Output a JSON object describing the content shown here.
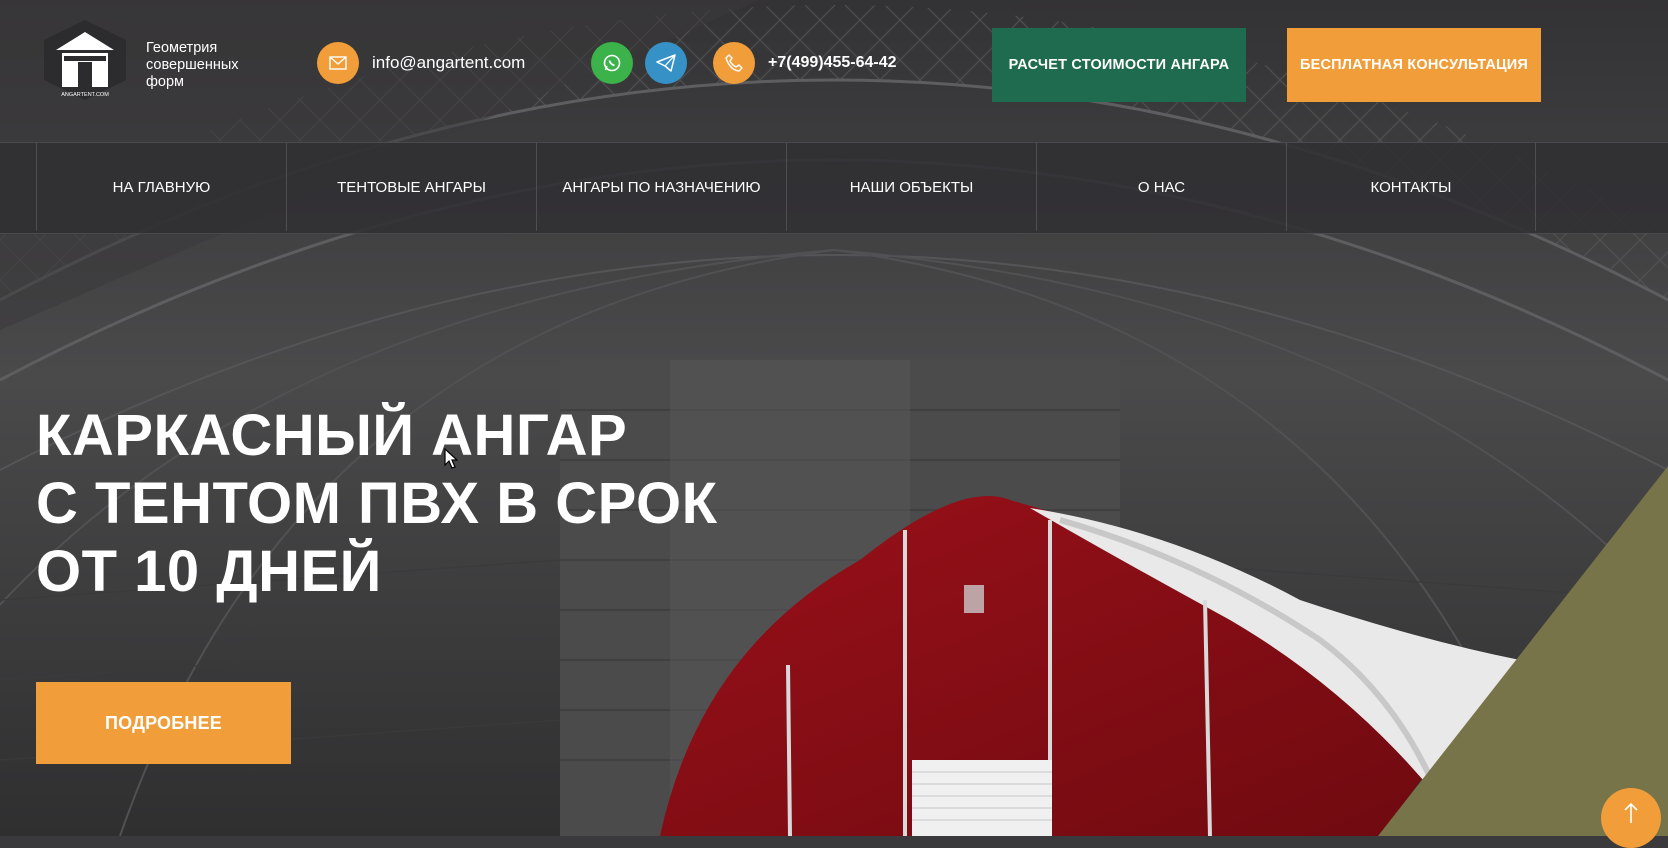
{
  "header": {
    "logo_text": "ANGARTENT.COM",
    "tagline": "Геометрия совершенных форм",
    "email": "info@angartent.com",
    "phone": "+7(499)455-64-42",
    "calc_button": "РАСЧЕТ СТОИМОСТИ АНГАРА",
    "consult_button": "БЕСПЛАТНАЯ КОНСУЛЬТАЦИЯ",
    "icons": [
      "email-icon",
      "whatsapp-icon",
      "telegram-icon",
      "phone-icon"
    ]
  },
  "nav": {
    "items": [
      {
        "label": "НА ГЛАВНУЮ"
      },
      {
        "label": "ТЕНТОВЫЕ АНГАРЫ"
      },
      {
        "label": "АНГАРЫ ПО НАЗНАЧЕНИЮ"
      },
      {
        "label": "НАШИ ОБЪЕКТЫ"
      },
      {
        "label": "О НАС"
      },
      {
        "label": "КОНТАКТЫ"
      }
    ]
  },
  "hero": {
    "title_lines": [
      "КАРКАСНЫЙ АНГАР",
      "С ТЕНТОМ ПВХ В СРОК",
      "ОТ 10 ДНЕЙ"
    ],
    "more_button": "ПОДРОБНЕЕ"
  },
  "colors": {
    "accent_orange": "#f09d3a",
    "green_button": "#1f6b4f",
    "olive_corner": "#777449",
    "hangar_red": "#8a0d14",
    "background": "#3a393b"
  }
}
